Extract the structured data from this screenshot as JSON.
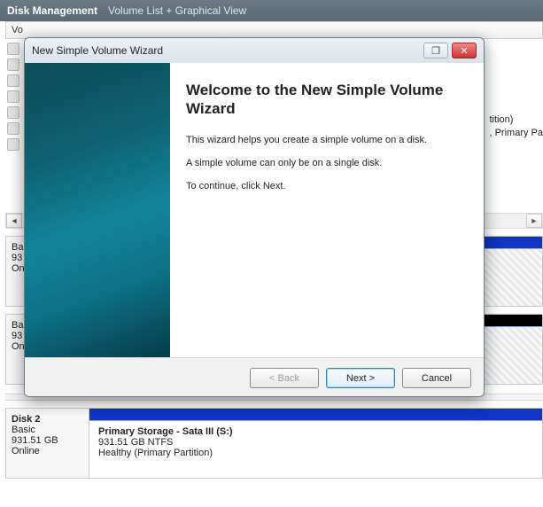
{
  "header": {
    "app_title": "Disk Management",
    "subtitle": "Volume List + Graphical View"
  },
  "list": {
    "first_col": "Vo"
  },
  "peek": {
    "line1": "tition)",
    "line2": ", Primary Pa"
  },
  "scrollbar": {
    "left": "◄",
    "right": "►"
  },
  "disks": {
    "d0": {
      "name": "",
      "type": "Ba",
      "size": "93",
      "status": "On"
    },
    "d1": {
      "name": "",
      "type": "Ba",
      "size": "93",
      "status": "On"
    },
    "d2": {
      "name": "Disk 2",
      "type": "Basic",
      "size": "931.51 GB",
      "status": "Online",
      "vol_name": "Primary Storage - Sata III  (S:)",
      "vol_info": "931.51 GB NTFS",
      "vol_health": "Healthy (Primary Partition)"
    }
  },
  "wizard": {
    "title": "New Simple Volume Wizard",
    "restore_icon": "❐",
    "close_icon": "✕",
    "heading": "Welcome to the New Simple Volume Wizard",
    "p1": "This wizard helps you create a simple volume on a disk.",
    "p2": "A simple volume can only be on a single disk.",
    "p3": "To continue, click Next.",
    "back_label": "< Back",
    "next_label": "Next >",
    "cancel_label": "Cancel"
  }
}
